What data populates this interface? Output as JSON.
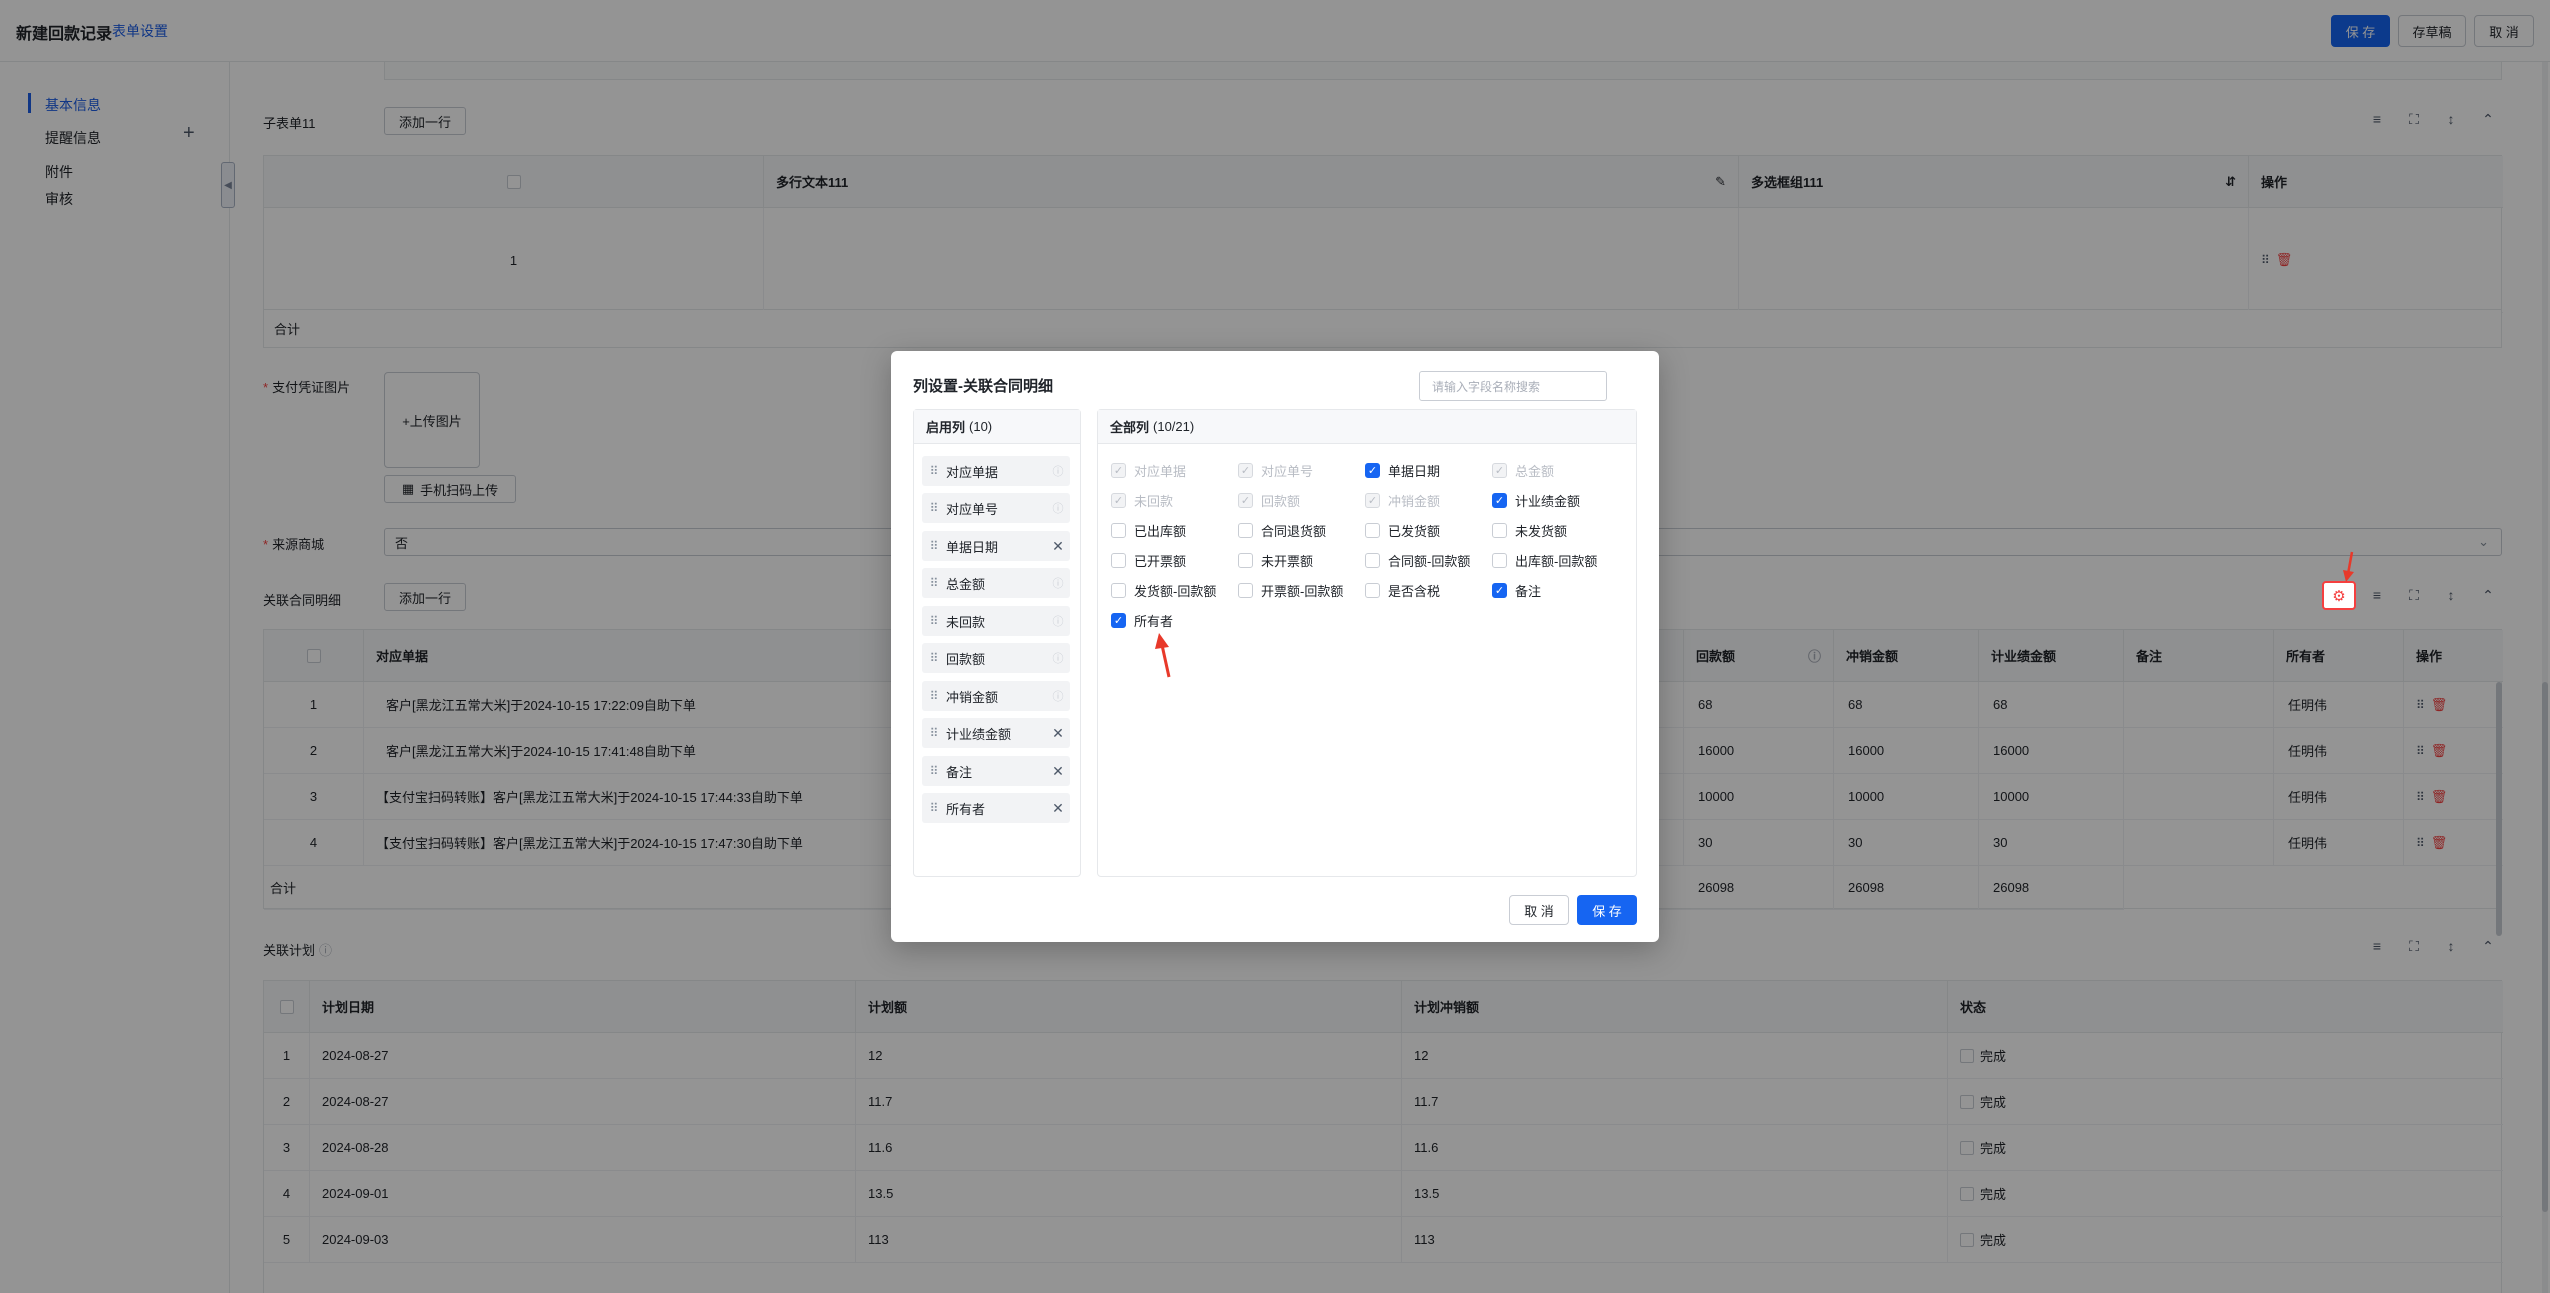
{
  "header": {
    "title": "新建回款记录",
    "settings_link": "表单设置",
    "save": "保 存",
    "draft": "存草稿",
    "cancel": "取 消"
  },
  "sidebar": {
    "items": [
      {
        "label": "基本信息"
      },
      {
        "label": "提醒信息"
      },
      {
        "label": "附件"
      },
      {
        "label": "审核"
      }
    ],
    "add_icon": "plus-icon",
    "collapse_icon": "chevron-left-icon"
  },
  "subtable": {
    "label": "子表单11",
    "add_row": "添加一行",
    "headers": [
      "多行文本111",
      "多选框组111",
      "操作"
    ],
    "rows": [
      {
        "index": "1"
      }
    ],
    "total_label": "合计"
  },
  "payment": {
    "label": "支付凭证图片",
    "upload": "+上传图片",
    "scan_upload": "手机扫码上传"
  },
  "source_mall": {
    "label": "来源商城",
    "value": "否"
  },
  "contract_detail": {
    "label": "关联合同明细",
    "add_row": "添加一行",
    "headers": [
      "对应单据",
      "回款额",
      "冲销金额",
      "计业绩金额",
      "备注",
      "所有者",
      "操作"
    ],
    "rows": [
      {
        "index": "1",
        "doc": "客户[黑龙江五常大米]于2024-10-15 17:22:09自助下单",
        "amount": "68",
        "offset": "68",
        "perf": "68",
        "note": "",
        "owner": "任明伟"
      },
      {
        "index": "2",
        "doc": "客户[黑龙江五常大米]于2024-10-15 17:41:48自助下单",
        "amount": "16000",
        "offset": "16000",
        "perf": "16000",
        "note": "",
        "owner": "任明伟"
      },
      {
        "index": "3",
        "doc": "【支付宝扫码转账】客户[黑龙江五常大米]于2024-10-15 17:44:33自助下单",
        "amount": "10000",
        "offset": "10000",
        "perf": "10000",
        "note": "",
        "owner": "任明伟"
      },
      {
        "index": "4",
        "doc": "【支付宝扫码转账】客户[黑龙江五常大米]于2024-10-15 17:47:30自助下单",
        "amount": "30",
        "offset": "30",
        "perf": "30",
        "note": "",
        "owner": "任明伟"
      }
    ],
    "total_label": "合计",
    "total_amount": "26098",
    "total_offset": "26098",
    "total_perf": "26098"
  },
  "plan": {
    "label": "关联计划",
    "headers": [
      "计划日期",
      "计划额",
      "计划冲销额",
      "状态"
    ],
    "rows": [
      {
        "index": "1",
        "date": "2024-08-27",
        "amount": "12",
        "offset": "12",
        "status": "完成"
      },
      {
        "index": "2",
        "date": "2024-08-27",
        "amount": "11.7",
        "offset": "11.7",
        "status": "完成"
      },
      {
        "index": "3",
        "date": "2024-08-28",
        "amount": "11.6",
        "offset": "11.6",
        "status": "完成"
      },
      {
        "index": "4",
        "date": "2024-09-01",
        "amount": "13.5",
        "offset": "13.5",
        "status": "完成"
      },
      {
        "index": "5",
        "date": "2024-09-03",
        "amount": "113",
        "offset": "113",
        "status": "完成"
      }
    ]
  },
  "dialog": {
    "title": "列设置-关联合同明细",
    "search_placeholder": "请输入字段名称搜索",
    "enabled_title": "启用列",
    "enabled_count": "(10)",
    "enabled": [
      {
        "label": "对应单据",
        "locked": true
      },
      {
        "label": "对应单号",
        "locked": true
      },
      {
        "label": "单据日期",
        "locked": false
      },
      {
        "label": "总金额",
        "locked": true
      },
      {
        "label": "未回款",
        "locked": true
      },
      {
        "label": "回款额",
        "locked": true
      },
      {
        "label": "冲销金额",
        "locked": true
      },
      {
        "label": "计业绩金额",
        "locked": false
      },
      {
        "label": "备注",
        "locked": false
      },
      {
        "label": "所有者",
        "locked": false
      }
    ],
    "all_title": "全部列",
    "all_count": "(10/21)",
    "all": [
      {
        "label": "对应单据",
        "state": "disabled"
      },
      {
        "label": "对应单号",
        "state": "disabled"
      },
      {
        "label": "单据日期",
        "state": "checked"
      },
      {
        "label": "总金额",
        "state": "disabled"
      },
      {
        "label": "未回款",
        "state": "disabled"
      },
      {
        "label": "回款额",
        "state": "disabled"
      },
      {
        "label": "冲销金额",
        "state": "disabled"
      },
      {
        "label": "计业绩金额",
        "state": "checked"
      },
      {
        "label": "已出库额",
        "state": "unchecked"
      },
      {
        "label": "合同退货额",
        "state": "unchecked"
      },
      {
        "label": "已发货额",
        "state": "unchecked"
      },
      {
        "label": "未发货额",
        "state": "unchecked"
      },
      {
        "label": "已开票额",
        "state": "unchecked"
      },
      {
        "label": "未开票额",
        "state": "unchecked"
      },
      {
        "label": "合同额-回款额",
        "state": "unchecked"
      },
      {
        "label": "出库额-回款额",
        "state": "unchecked"
      },
      {
        "label": "发货额-回款额",
        "state": "unchecked"
      },
      {
        "label": "开票额-回款额",
        "state": "unchecked"
      },
      {
        "label": "是否含税",
        "state": "unchecked"
      },
      {
        "label": "备注",
        "state": "checked"
      },
      {
        "label": "所有者",
        "state": "checked"
      }
    ],
    "cancel": "取 消",
    "save": "保 存"
  },
  "colors": {
    "primary": "#1665f2",
    "danger": "#f53f3f",
    "annotation": "#e8392a"
  }
}
